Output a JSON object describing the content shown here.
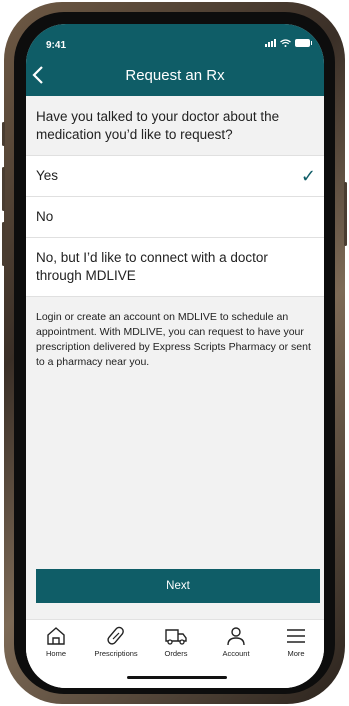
{
  "status_bar": {
    "time": "9:41"
  },
  "header": {
    "back_icon": "chevron-left-icon",
    "title": "Request an Rx"
  },
  "question": "Have you talked to your doctor about the medication you’d like to request?",
  "options": [
    {
      "label": "Yes",
      "selected": true
    },
    {
      "label": "No",
      "selected": false
    },
    {
      "label": "No, but I’d like to connect with a doctor through MDLIVE",
      "selected": false
    }
  ],
  "info_text": "Login or create an account on MDLIVE to schedule an appointment. With MDLIVE, you can request to have your prescription delivered by Express Scripts Pharmacy or sent to a pharmacy near you.",
  "next_label": "Next",
  "tabs": [
    {
      "label": "Home",
      "icon": "home-icon"
    },
    {
      "label": "Prescriptions",
      "icon": "pill-icon"
    },
    {
      "label": "Orders",
      "icon": "truck-icon"
    },
    {
      "label": "Account",
      "icon": "person-icon"
    },
    {
      "label": "More",
      "icon": "menu-icon"
    }
  ],
  "colors": {
    "brand": "#0f5d67",
    "background": "#f2f2f2"
  }
}
